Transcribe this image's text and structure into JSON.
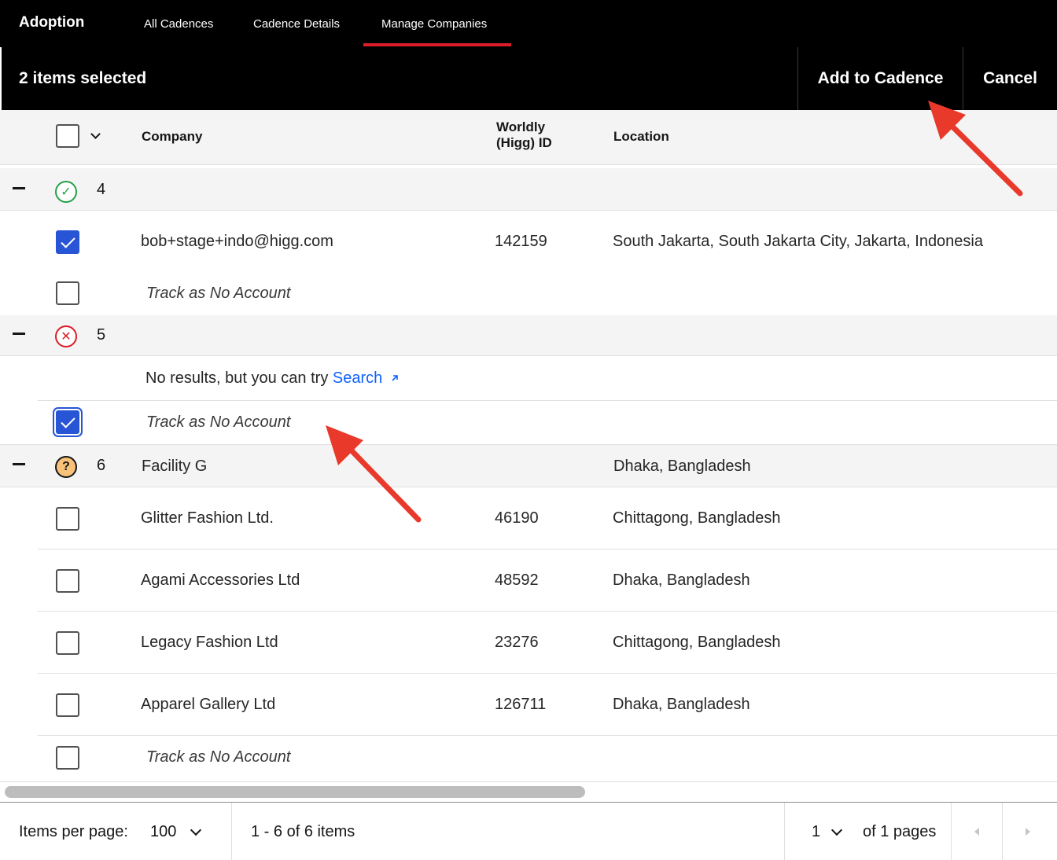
{
  "nav": {
    "brand": "Adoption",
    "tabs": [
      {
        "label": "All Cadences"
      },
      {
        "label": "Cadence Details"
      },
      {
        "label": "Manage Companies"
      }
    ]
  },
  "batch": {
    "count_text": "2 items selected",
    "add_label": "Add to Cadence",
    "cancel_label": "Cancel"
  },
  "table": {
    "headers": {
      "company": "Company",
      "worldly_line1": "Worldly",
      "worldly_line2": "(Higg) ID",
      "location": "Location"
    },
    "groups": [
      {
        "number": "4",
        "status": "matched",
        "rows": [
          {
            "company": "bob+stage+indo@higg.com",
            "id": "142159",
            "location": "South Jakarta, South Jakarta City, Jakarta, Indonesia",
            "checked": true
          },
          {
            "company": "Track as No Account",
            "checked": false
          }
        ]
      },
      {
        "number": "5",
        "status": "no-match",
        "message": "No results, but you can try",
        "message_link": "Search",
        "rows": [
          {
            "company": "Track as No Account",
            "checked": true
          }
        ]
      },
      {
        "number": "6",
        "status": "uncertain",
        "name": "Facility G",
        "location": "Dhaka, Bangladesh",
        "rows": [
          {
            "company": "Glitter Fashion Ltd.",
            "id": "46190",
            "location": "Chittagong, Bangladesh",
            "checked": false
          },
          {
            "company": "Agami Accessories Ltd",
            "id": "48592",
            "location": "Dhaka, Bangladesh",
            "checked": false
          },
          {
            "company": "Legacy Fashion Ltd",
            "id": "23276",
            "location": "Chittagong, Bangladesh",
            "checked": false
          },
          {
            "company": "Apparel Gallery Ltd",
            "id": "126711",
            "location": "Dhaka, Bangladesh",
            "checked": false
          },
          {
            "company": "Track as No Account",
            "checked": false
          }
        ]
      }
    ]
  },
  "pagination": {
    "items_per_page_label": "Items per page:",
    "items_per_page_value": "100",
    "range_text": "1 - 6 of 6 items",
    "page_value": "1",
    "of_pages_text": "of 1 pages"
  },
  "colors": {
    "accent_blue": "#2854d6",
    "tab_underline": "#da1e28",
    "annotation_arrow": "#e8392a",
    "status_ok": "#24a148",
    "status_error": "#da1e28",
    "status_warn_fill": "#f8c27a"
  }
}
